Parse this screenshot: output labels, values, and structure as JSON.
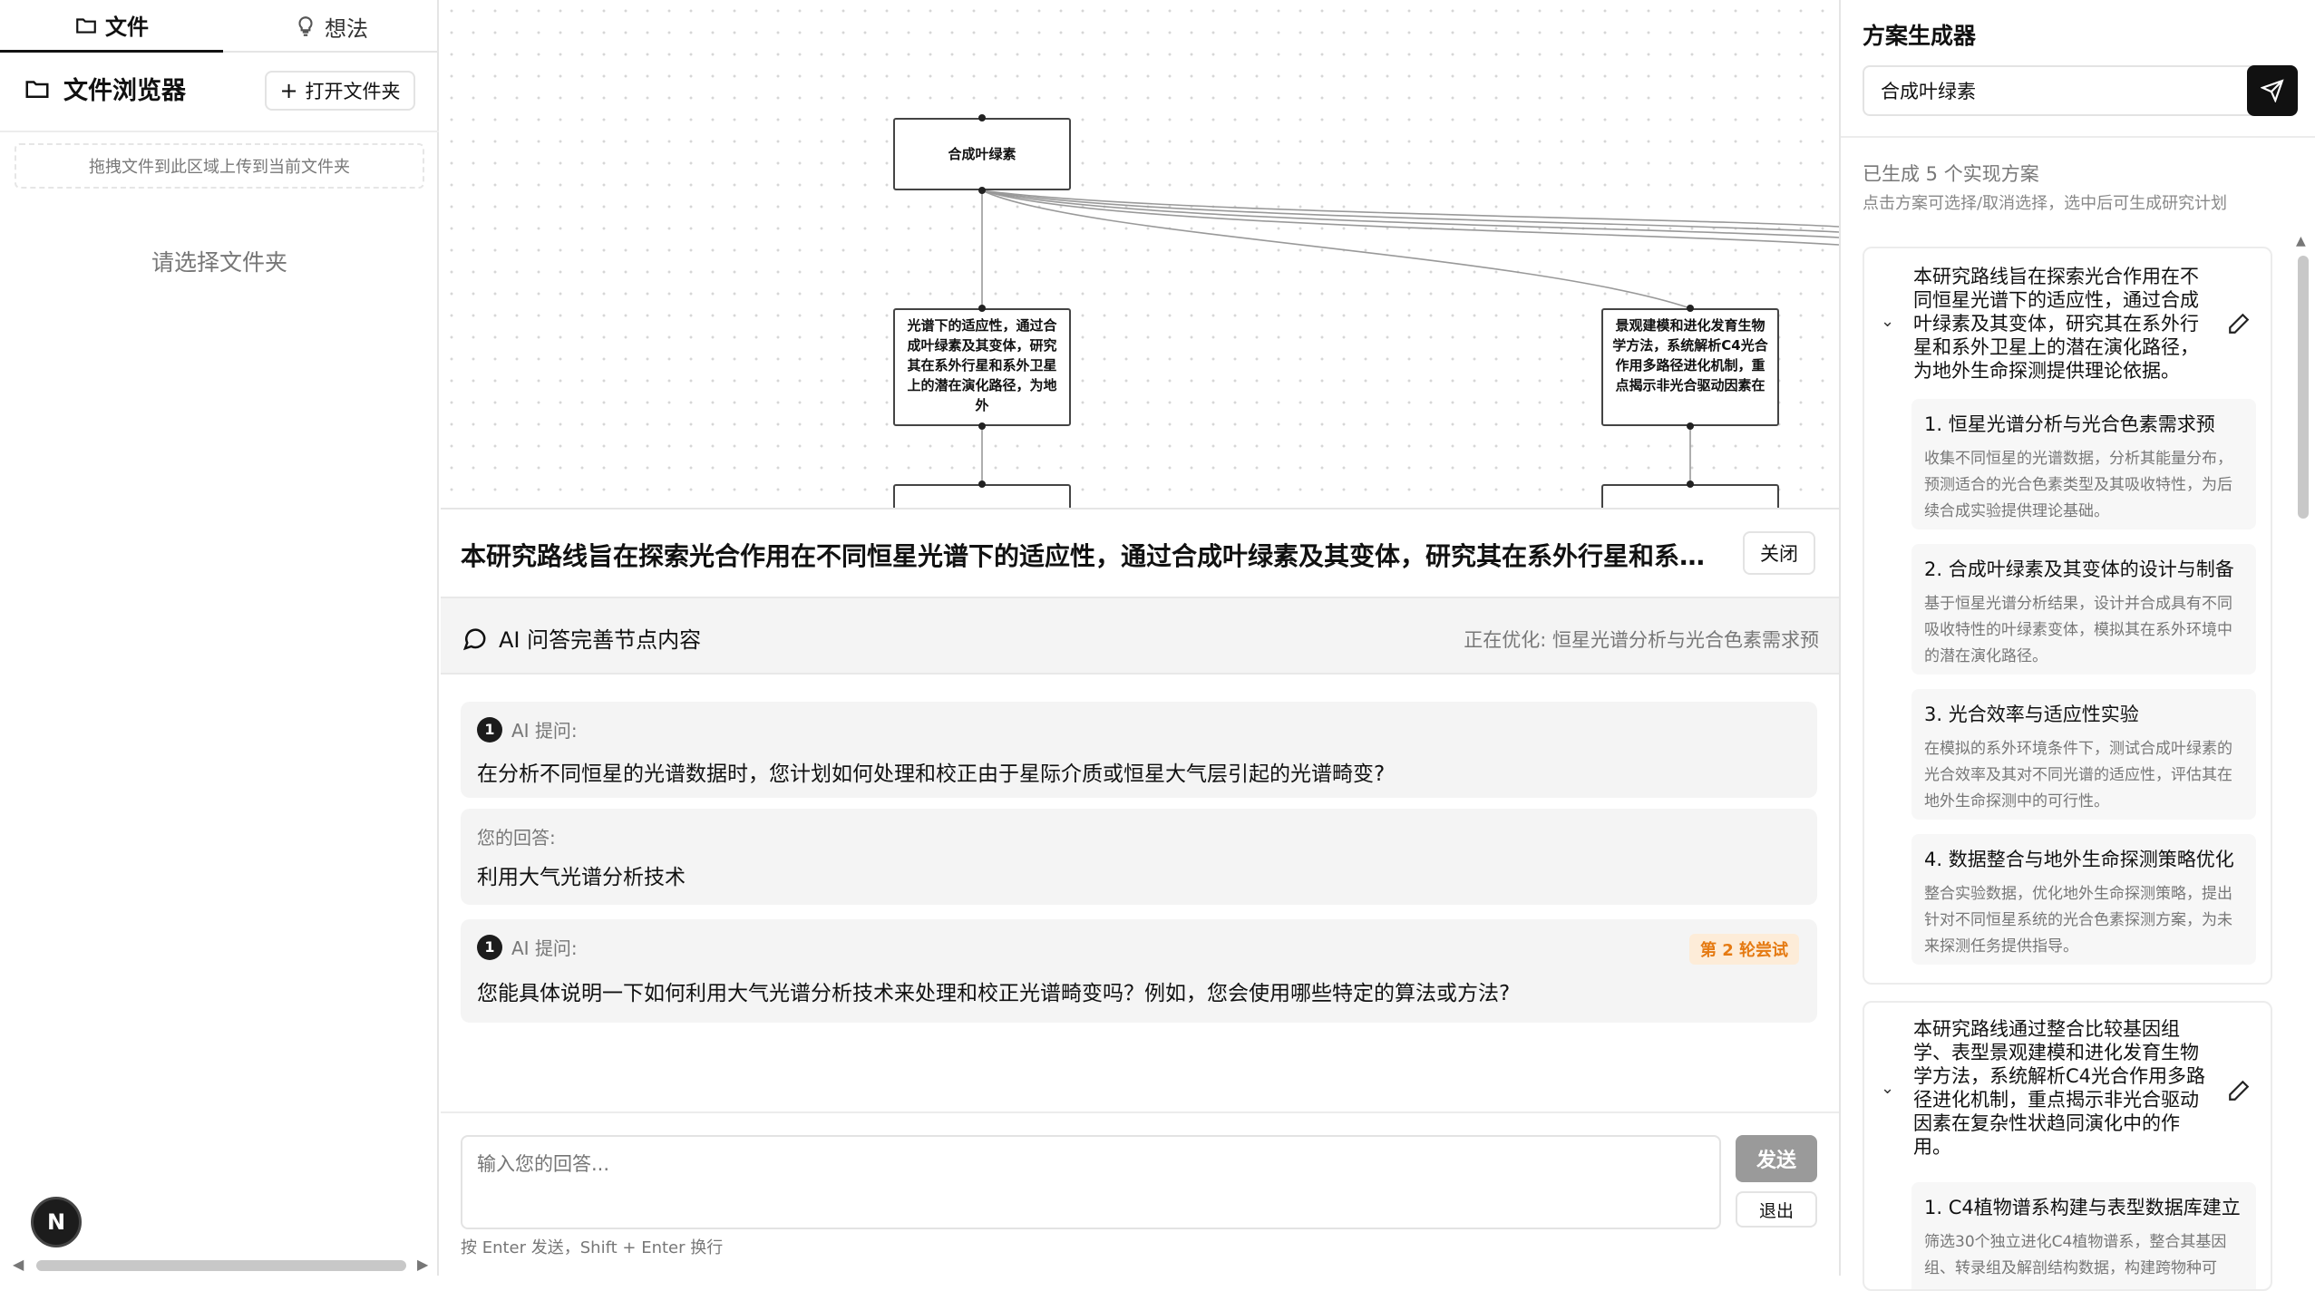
{
  "left": {
    "tabs": [
      {
        "label": "文件"
      },
      {
        "label": "想法"
      }
    ],
    "browser_title": "文件浏览器",
    "open_folder": "打开文件夹",
    "drop_hint": "拖拽文件到此区域上传到当前文件夹",
    "empty": "请选择文件夹",
    "avatar": "N"
  },
  "canvas": {
    "root": "合成叶绿素",
    "node_a": "光谱下的适应性，通过合成叶绿素及其变体，研究其在系外行星和系外卫星上的潜在演化路径，为地外",
    "node_b": "景观建模和进化发育生物学方法，系统解析C4光合作用多路径进化机制，重点揭示非光合驱动因素在"
  },
  "center": {
    "title": "本研究路线旨在探索光合作用在不同恒星光谱下的适应性，通过合成叶绿素及其变体，研究其在系外行星和系外卫...",
    "close": "关闭",
    "qa_title": "AI 问答完善节点内容",
    "status": "正在优化: 恒星光谱分析与光合色素需求预",
    "q1": {
      "num": "1",
      "label": "AI 提问:",
      "text": "在分析不同恒星的光谱数据时，您计划如何处理和校正由于星际介质或恒星大气层引起的光谱畸变?"
    },
    "a1": {
      "label": "您的回答:",
      "text": "利用大气光谱分析技术"
    },
    "q2": {
      "num": "1",
      "label": "AI 提问:",
      "badge": "第 2 轮尝试",
      "text": "您能具体说明一下如何利用大气光谱分析技术来处理和校正光谱畸变吗？例如，您会使用哪些特定的算法或方法?"
    },
    "answer_placeholder": "输入您的回答...",
    "send": "发送",
    "exit": "退出",
    "hint": "按 Enter 发送，Shift + Enter 换行"
  },
  "right": {
    "title": "方案生成器",
    "input_value": "合成叶绿素",
    "count": "已生成 5 个实现方案",
    "sub": "点击方案可选择/取消选择，选中后可生成研究计划",
    "plans": [
      {
        "text": "本研究路线旨在探索光合作用在不同恒星光谱下的适应性，通过合成叶绿素及其变体，研究其在系外行星和系外卫星上的潜在演化路径，为地外生命探测提供理论依据。",
        "steps": [
          {
            "title": "1. 恒星光谱分析与光合色素需求预",
            "desc": "收集不同恒星的光谱数据，分析其能量分布，预测适合的光合色素类型及其吸收特性，为后续合成实验提供理论基础。"
          },
          {
            "title": "2. 合成叶绿素及其变体的设计与制备",
            "desc": "基于恒星光谱分析结果，设计并合成具有不同吸收特性的叶绿素变体，模拟其在系外环境中的潜在演化路径。"
          },
          {
            "title": "3. 光合效率与适应性实验",
            "desc": "在模拟的系外环境条件下，测试合成叶绿素的光合效率及其对不同光谱的适应性，评估其在地外生命探测中的可行性。"
          },
          {
            "title": "4. 数据整合与地外生命探测策略优化",
            "desc": "整合实验数据，优化地外生命探测策略，提出针对不同恒星系统的光合色素探测方案，为未来探测任务提供指导。"
          }
        ]
      },
      {
        "text": "本研究路线通过整合比较基因组学、表型景观建模和进化发育生物学方法，系统解析C4光合作用多路径进化机制，重点揭示非光合驱动因素在复杂性状趋同演化中的作用。",
        "steps": [
          {
            "title": "1. C4植物谱系构建与表型数据库建立",
            "desc": "筛选30个独立进化C4植物谱系，整合其基因组、转录组及解剖结构数据，构建跨物种可"
          }
        ]
      }
    ]
  }
}
